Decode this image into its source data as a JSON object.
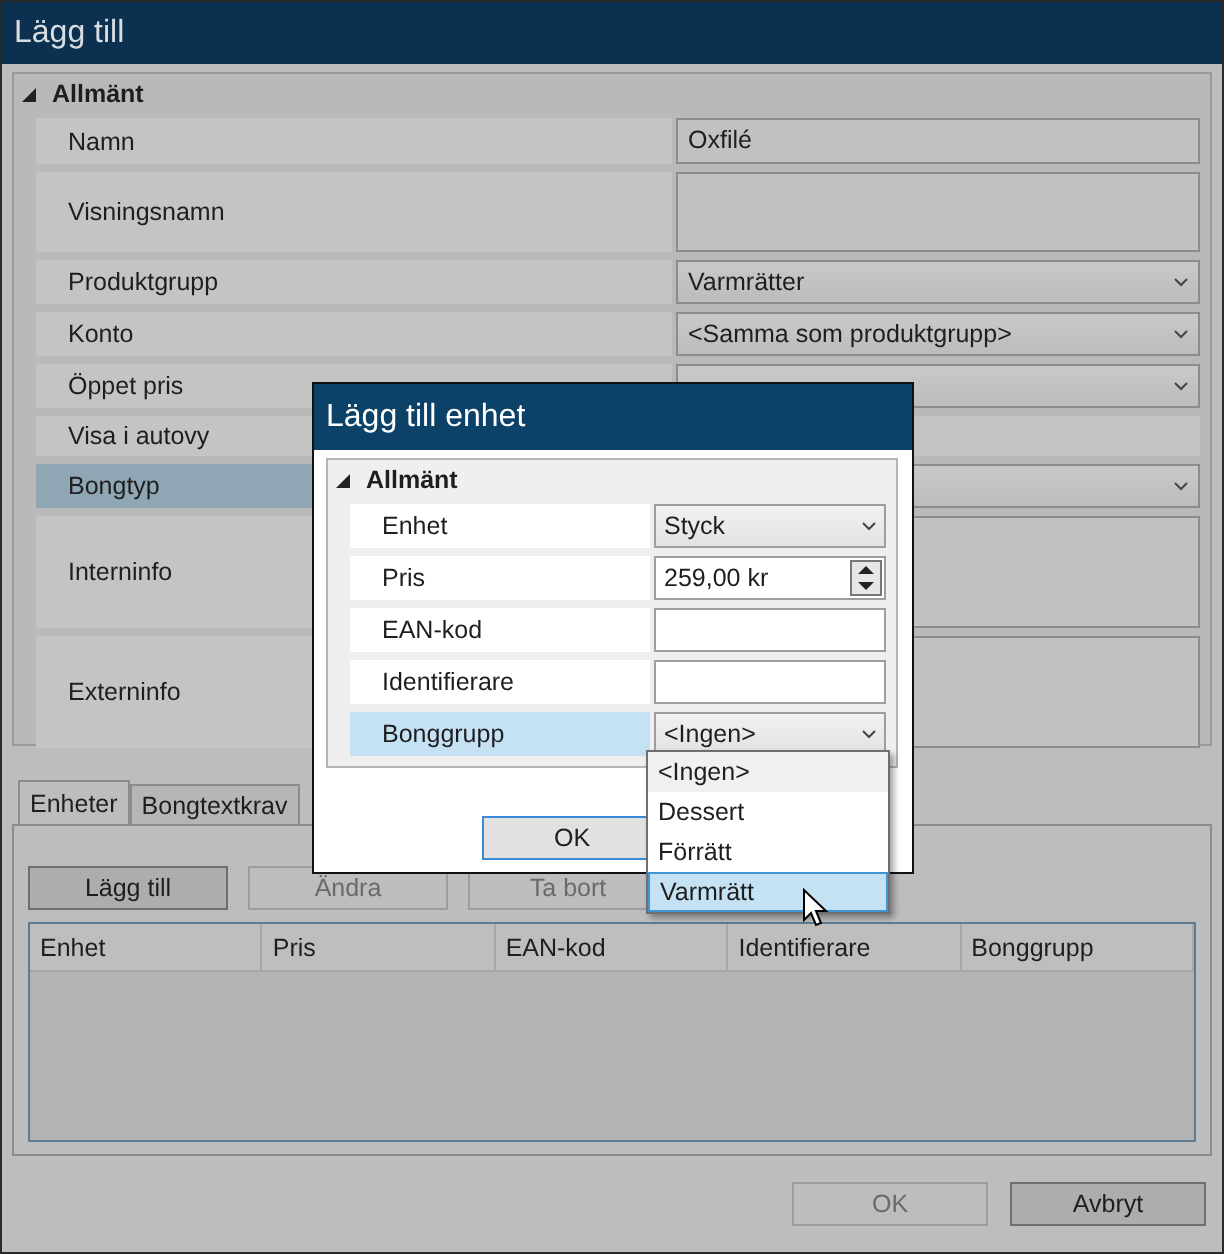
{
  "window": {
    "title": "Lägg till"
  },
  "properties": {
    "section": "Allmänt",
    "expanded": true,
    "rows": [
      {
        "label": "Namn",
        "kind": "text",
        "value": "Oxfilé",
        "selected": false
      },
      {
        "label": "Visningsnamn",
        "kind": "textarea",
        "selected": false
      },
      {
        "label": "Produktgrupp",
        "kind": "combo",
        "value": "Varmrätter",
        "selected": false
      },
      {
        "label": "Konto",
        "kind": "combo",
        "value": "<Samma som produktgrupp>",
        "selected": false
      },
      {
        "label": "Öppet pris",
        "kind": "combo",
        "selected": false
      },
      {
        "label": "Visa i autovy",
        "kind": "blank",
        "selected": false
      },
      {
        "label": "Bongtyp",
        "kind": "combo",
        "selected": true
      },
      {
        "label": "Interninfo",
        "kind": "textarea",
        "selected": false
      },
      {
        "label": "Externinfo",
        "kind": "textarea",
        "selected": false
      }
    ]
  },
  "tabs": [
    {
      "label": "Enheter",
      "selected": true
    },
    {
      "label": "Bongtextkrav",
      "selected": false
    }
  ],
  "unit_buttons": [
    {
      "label": "Lägg till",
      "disabled": false
    },
    {
      "label": "Ändra",
      "disabled": true
    },
    {
      "label": "Ta bort",
      "disabled": true
    }
  ],
  "table": {
    "columns": [
      "Enhet",
      "Pris",
      "EAN-kod",
      "Identifierare",
      "Bonggrupp"
    ]
  },
  "footer_buttons": [
    {
      "label": "OK",
      "disabled": true
    },
    {
      "label": "Avbryt",
      "disabled": false
    }
  ],
  "dialog": {
    "title": "Lägg till enhet",
    "section": "Allmänt",
    "expanded": true,
    "rows": [
      {
        "label": "Enhet",
        "kind": "combo",
        "value": "Styck",
        "selected": false
      },
      {
        "label": "Pris",
        "kind": "spin",
        "value": "259,00 kr",
        "selected": false
      },
      {
        "label": "EAN-kod",
        "kind": "text",
        "selected": false
      },
      {
        "label": "Identifierare",
        "kind": "text",
        "selected": false
      },
      {
        "label": "Bonggrupp",
        "kind": "combo",
        "value": "<Ingen>",
        "selected": true
      }
    ],
    "ok_button": "OK",
    "dropdown": [
      {
        "label": "<Ingen>",
        "selected": false
      },
      {
        "label": "Dessert",
        "selected": false
      },
      {
        "label": "Förrätt",
        "selected": false
      },
      {
        "label": "Varmrätt",
        "selected": true
      }
    ]
  }
}
